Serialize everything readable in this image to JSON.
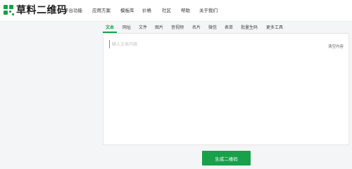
{
  "header": {
    "logo_text": "草料二维码",
    "nav": [
      "平台功能",
      "应用方案",
      "模板库",
      "价格",
      "社区",
      "帮助",
      "关于我们"
    ]
  },
  "tabs": [
    "文本",
    "网址",
    "文件",
    "图片",
    "音视频",
    "名片",
    "微信",
    "表单",
    "批量生码",
    "更多工具"
  ],
  "active_tab": "文本",
  "editor": {
    "placeholder": "输入文本内容",
    "clear_label": "清空内容"
  },
  "generate_label": "生成二维码",
  "colors": {
    "accent": "#19a04a"
  }
}
